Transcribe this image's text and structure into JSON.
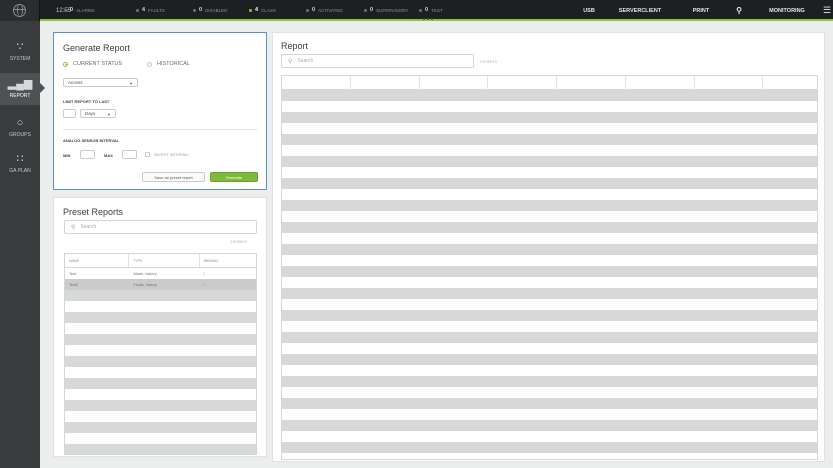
{
  "topbar": {
    "time": "12:55",
    "stats": [
      {
        "count": "0",
        "label": "Alarms",
        "active": false
      },
      {
        "count": "4",
        "label": "Faults",
        "active": false
      },
      {
        "count": "0",
        "label": "Disabled",
        "active": false
      },
      {
        "count": "4",
        "label": "Class",
        "active": true
      },
      {
        "count": "0",
        "label": "Activated",
        "active": false
      },
      {
        "count": "0",
        "label": "Supervisory",
        "active": false
      },
      {
        "count": "0",
        "label": "Test",
        "active": false
      }
    ],
    "right": [
      "USB",
      "ServerClient",
      "PRINT",
      "MONITORING"
    ],
    "accent": "#8cc63f"
  },
  "sidebar": {
    "items": [
      {
        "label": "SYSTEM",
        "icon": "network-icon",
        "active": false
      },
      {
        "label": "REPORT",
        "icon": "bar-chart-icon",
        "active": true
      },
      {
        "label": "GROUPS",
        "icon": "groups-icon",
        "active": false
      },
      {
        "label": "GA PLAN",
        "icon": "grid-icon",
        "active": false
      }
    ]
  },
  "generate": {
    "title": "Generate Report",
    "mode_current": "CURRENT STATUS",
    "mode_historical": "HISTORICAL",
    "type_value": "Access",
    "limit_label": "LIMIT REPORT TO LAST",
    "period_unit": "Days",
    "analog_label": "ANALOG SENSOR INTERVAL",
    "min_label": "MIN",
    "max_label": "MAX",
    "invert_label": "INVERT INTERVAL",
    "save_btn": "Save as preset report",
    "generate_btn": "Generate"
  },
  "preset": {
    "title": "Preset Reports",
    "search_placeholder": "Search",
    "count": "2 EVENTS",
    "columns": [
      "NAME",
      "TYPE",
      "MIN/MAX"
    ],
    "rows": [
      {
        "name": "Test",
        "type": "Alarm, history",
        "minmax": "/"
      },
      {
        "name": "Test2",
        "type": "Faults, history",
        "minmax": "/"
      }
    ]
  },
  "report": {
    "title": "Report",
    "search_placeholder": "Search",
    "count": "0 EVENTS"
  }
}
